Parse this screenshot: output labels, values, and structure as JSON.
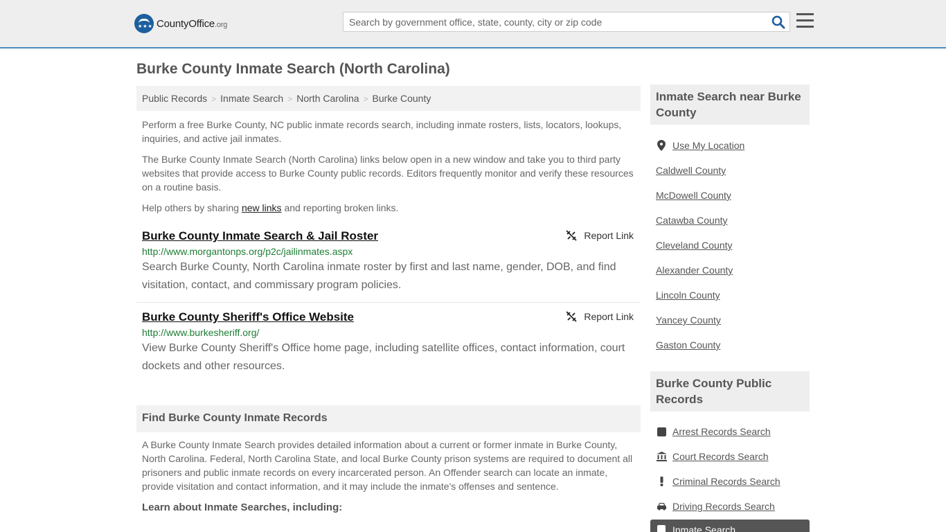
{
  "header": {
    "logo_main": "CountyOffice",
    "logo_suffix": ".org",
    "search_placeholder": "Search by government office, state, county, city or zip code"
  },
  "page": {
    "title": "Burke County Inmate Search (North Carolina)",
    "breadcrumb": [
      "Public Records",
      "Inmate Search",
      "North Carolina",
      "Burke County"
    ],
    "intro1": "Perform a free Burke County, NC public inmate records search, including inmate rosters, lists, locators, lookups, inquiries, and active jail inmates.",
    "intro2": "The Burke County Inmate Search (North Carolina) links below open in a new window and take you to third party websites that provide access to Burke County public records. Editors frequently monitor and verify these resources on a routine basis.",
    "intro3_before": "Help others by sharing ",
    "intro3_link": "new links",
    "intro3_after": " and reporting broken links."
  },
  "results": [
    {
      "title": "Burke County Inmate Search & Jail Roster",
      "report": "Report Link",
      "url": "http://www.morgantonps.org/p2c/jailinmates.aspx",
      "desc": "Search Burke County, North Carolina inmate roster by first and last name, gender, DOB, and find visitation, contact, and commissary program policies."
    },
    {
      "title": "Burke County Sheriff's Office Website",
      "report": "Report Link",
      "url": "http://www.burkesheriff.org/",
      "desc": "View Burke County Sheriff's Office home page, including satellite offices, contact information, court dockets and other resources."
    }
  ],
  "find": {
    "heading": "Find Burke County Inmate Records",
    "text": "A Burke County Inmate Search provides detailed information about a current or former inmate in Burke County, North Carolina. Federal, North Carolina State, and local Burke County prison systems are required to document all prisoners and public inmate records on every incarcerated person. An Offender search can locate an inmate, provide visitation and contact information, and it may include the inmate's offenses and sentence.",
    "learn": "Learn about Inmate Searches, including:"
  },
  "sidebar": {
    "nearby_heading": "Inmate Search near Burke County",
    "my_location": "Use My Location",
    "counties": [
      "Caldwell County",
      "McDowell County",
      "Catawba County",
      "Cleveland County",
      "Alexander County",
      "Lincoln County",
      "Yancey County",
      "Gaston County"
    ],
    "records_heading": "Burke County Public Records",
    "records": [
      {
        "label": "Arrest Records Search",
        "icon": "square-icon"
      },
      {
        "label": "Court Records Search",
        "icon": "courthouse-icon"
      },
      {
        "label": "Criminal Records Search",
        "icon": "exclamation-icon"
      },
      {
        "label": "Driving Records Search",
        "icon": "car-icon"
      }
    ],
    "active_record": "Inmate Search"
  },
  "colors": {
    "accent_border": "#4a8bc4",
    "url_green": "#1e7e34",
    "active_bg": "#555555"
  }
}
